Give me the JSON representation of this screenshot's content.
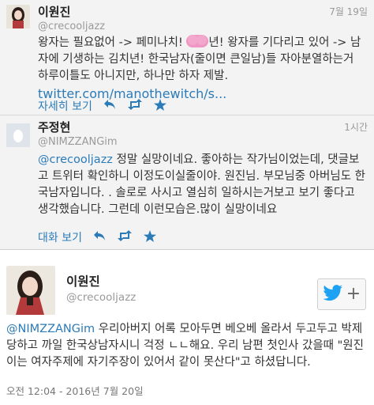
{
  "tweets": [
    {
      "name": "이원진",
      "handle": "@crecooljazz",
      "time": "7월 19일",
      "text_parts": {
        "a": "왕자는 필요없어 -> 페미나치! ",
        "b": "년! 왕자를 기다리고 있어 -> 남자에 기생하는 김치년! 한국남자(줄이면 큰일남)들 자아분열하는거 하루이틀도 아니지만, 하나만 하자 제발.",
        "link": "twitter.com/manothewitch/s..."
      },
      "more_label": "자세히 보기"
    },
    {
      "name": "주정현",
      "handle": "@NIMZZANGim",
      "time": "1시간",
      "mention": "@crecooljazz",
      "text": " 정말 실망이네요. 좋아하는 작가님이었는데, 댓글보고 트위터 확인하니 이정도이실줄이야. 원진님. 부모님중 아버님도 한국남자입니다. . 솔로로 사시고 열심히 일하시는거보고 보기 좋다고 생각했습니다. 그런데 이런모습은.많이 실망이네요",
      "more_label": "대화 보기"
    },
    {
      "name": "이원진",
      "handle": "@crecooljazz",
      "mention": "@NIMZZANGim",
      "text": " 우리아버지 어록 모아두면 베오베 올라서 두고두고 박제당하고 까일 한국상남자시니 걱정 ㄴㄴ해요. 우리 남편 첫인사 갔을때 \"원진이는 여자주제에 자기주장이 있어서 같이 못산다\"고 하셨답니다.",
      "footer": "오전 12:04 - 2016년 7월 20일"
    }
  ],
  "icons": {
    "reply": "reply-icon",
    "retweet": "retweet-icon",
    "favorite": "star-icon",
    "follow": "twitter-bird-icon"
  },
  "colors": {
    "link": "#2b7bb9",
    "bird": "#1da1f2"
  }
}
